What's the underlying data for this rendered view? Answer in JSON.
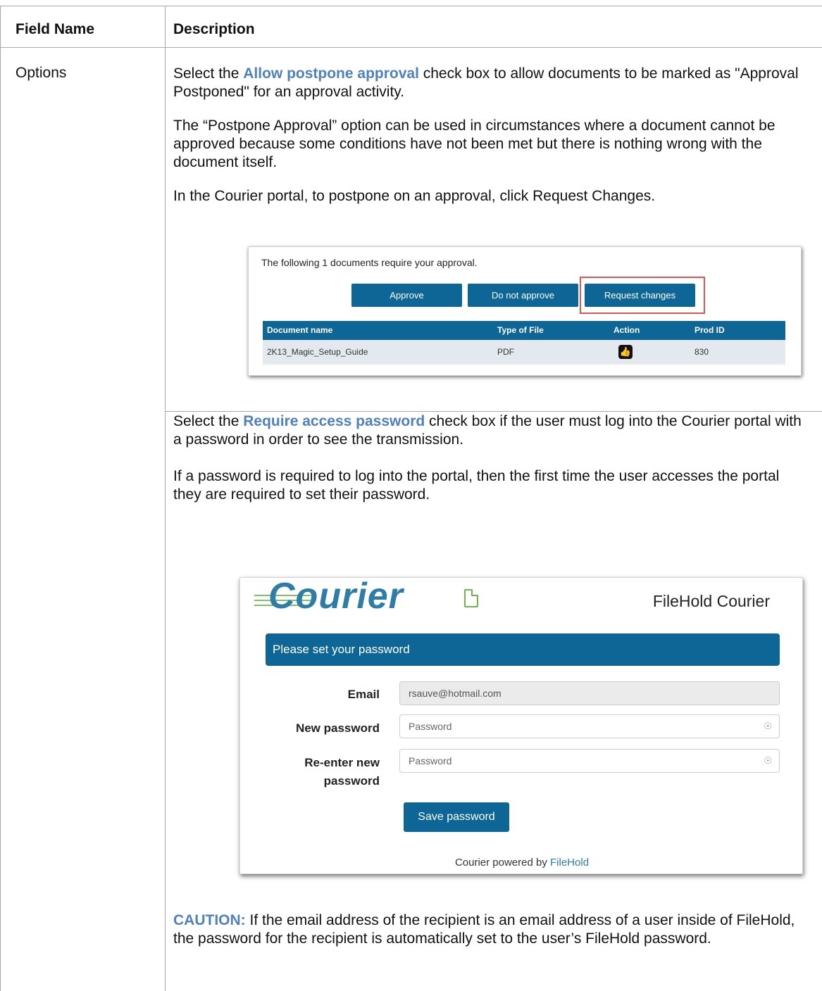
{
  "table": {
    "header_field": "Field Name",
    "header_description": "Description",
    "field_name": "Options"
  },
  "paragraphs": {
    "p1_pre": "Select the ",
    "p1_highlight": "Allow postpone approval",
    "p1_post": " check box to allow documents to be marked as \"Approval Postponed\" for an approval activity.",
    "p2": "The “Postpone Approval” option can be used in circumstances where a document cannot be approved because some conditions have not been met but there is nothing wrong with the document itself.",
    "p3": "In the Courier portal, to postpone on an approval, click Request Changes.",
    "p4_pre": "Select the ",
    "p4_highlight": "Require access password",
    "p4_post": " check box if the user must log into the Courier portal with a password in order to see the transmission.",
    "p5": "If a password is required to log into the portal, then the first time the user accesses the portal they are required to set their password.",
    "caution_label": "CAUTION:",
    "caution_text": " If the email address of the recipient is an email address of a user inside of FileHold, the password for the recipient is automatically set to the user’s FileHold password."
  },
  "approval_screenshot": {
    "intro": "The following 1 documents require your approval.",
    "buttons": [
      "Approve",
      "Do not approve",
      "Request changes"
    ],
    "columns": [
      "Document name",
      "Type of File",
      "Action",
      "Prod ID"
    ],
    "row": {
      "name": "2K13_Magic_Setup_Guide",
      "type": "PDF",
      "action_icon": "thumbs-up-icon",
      "prod_id": "830"
    }
  },
  "password_screenshot": {
    "logo": "Courier",
    "brand": "FileHold Courier",
    "banner": "Please set your password",
    "email_label": "Email",
    "email_value": "rsauve@hotmail.com",
    "new_password_label": "New password",
    "new_password_placeholder": "Password",
    "reenter_label_1": "Re-enter new",
    "reenter_label_2": "password",
    "reenter_placeholder": "Password",
    "save_button": "Save password",
    "footer_pre": "Courier  powered by ",
    "footer_link": "FileHold"
  },
  "colors": {
    "accent_blue": "#0e6696",
    "highlight_text": "#4f81bd",
    "logo_green": "#6fb84d",
    "callout_red": "#e05555"
  }
}
